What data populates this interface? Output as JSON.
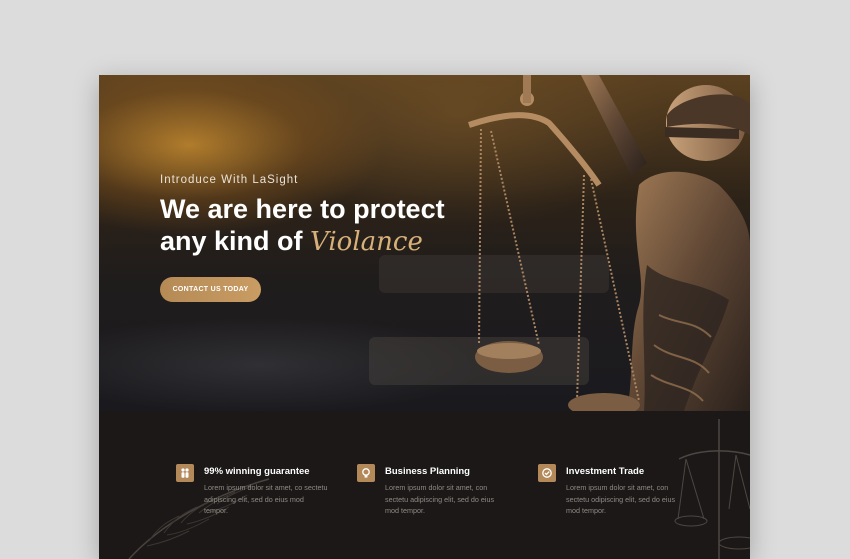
{
  "hero": {
    "intro": "Introduce With LaSight",
    "headline_line1": "We are here to protect",
    "headline_line2_prefix": "any kind of",
    "headline_accent": "Violance",
    "cta_label": "CONTACT US TODAY"
  },
  "features": [
    {
      "icon": "people-icon",
      "title": "99% winning guarantee",
      "text": "Lorem ipsum dolor sit amet, co sectetu adipiscing elit, sed do eius mod tempor."
    },
    {
      "icon": "lightbulb-icon",
      "title": "Business Planning",
      "text": "Lorem ipsum dolor sit amet, con sectetu adipiscing elit, sed do eius mod tempor."
    },
    {
      "icon": "badge-check-icon",
      "title": "Investment Trade",
      "text": "Lorem ipsum dolor sit amet, con sectetu odipiscing elit, sed do eius mod tempor."
    }
  ],
  "colors": {
    "accent_gold": "#b4895a",
    "accent_text": "#d8b079",
    "dark_bg": "#1b1817",
    "outer_bg": "#dcdcdc"
  }
}
